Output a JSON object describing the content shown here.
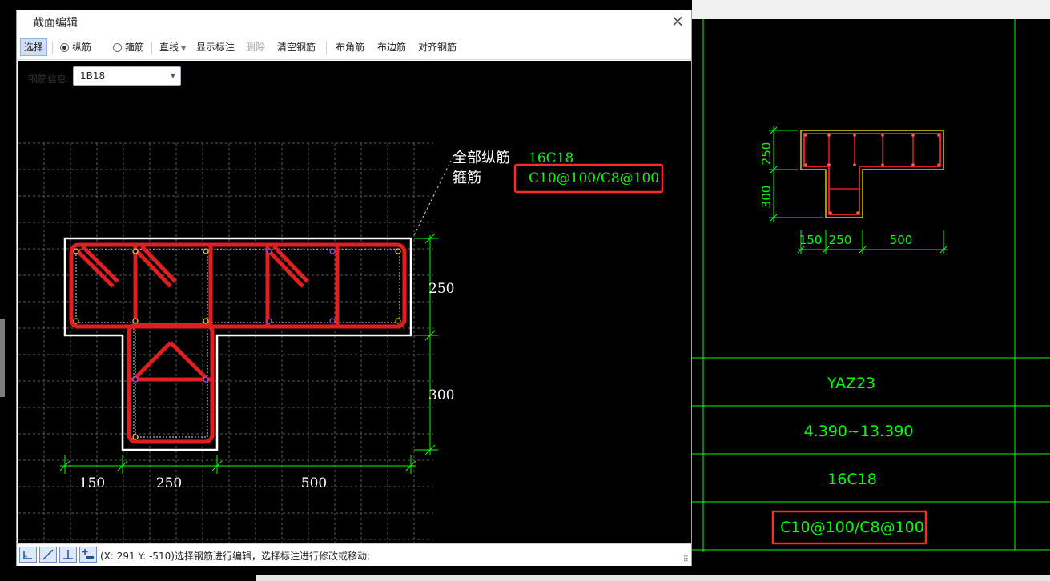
{
  "dialog": {
    "title": "截面编辑",
    "close_symbol": "×",
    "toolbar": {
      "select_label": "选择",
      "radio_longitudinal_label": "纵筋",
      "radio_stirrup_label": "箍筋",
      "line_label": "直线",
      "show_annotation_label": "显示标注",
      "delete_label": "删除",
      "clear_rebar_label": "清空钢筋",
      "corner_rebar_label": "布角筋",
      "edge_rebar_label": "布边筋",
      "align_rebar_label": "对齐钢筋"
    },
    "rebar_info": {
      "label": "钢筋信息:",
      "value": "1B18"
    },
    "annotation": {
      "all_longitudinal_label": "全部纵筋",
      "all_longitudinal_value": "16C18",
      "stirrup_label": "箍筋",
      "stirrup_value": "C10@100/C8@100"
    },
    "dimensions": {
      "height_flange": "250",
      "height_web": "300",
      "width_left": "150",
      "width_web": "250",
      "width_right": "500"
    },
    "status_text": "(X: 291 Y: -510)选择钢筋进行编辑，选择标注进行修改或移动;",
    "status_buttons": [
      "orthogonal-icon",
      "line-draw-icon",
      "perpendicular-icon",
      "add-point-icon"
    ]
  },
  "cad_table": {
    "section_dims": {
      "h1": "250",
      "h2": "300",
      "w1": "150",
      "w2": "250",
      "w3": "500"
    },
    "name": "YAZ23",
    "elevation": "4.390~13.390",
    "longitudinal": "16C18",
    "stirrup": "C10@100/C8@100"
  },
  "colors": {
    "cad_green": "#00ff00",
    "rebar_red": "#e02020",
    "highlight_red": "#ff2a2a",
    "outline_yellow": "#ffff00",
    "toolbar_active": "#cfe0f5"
  }
}
